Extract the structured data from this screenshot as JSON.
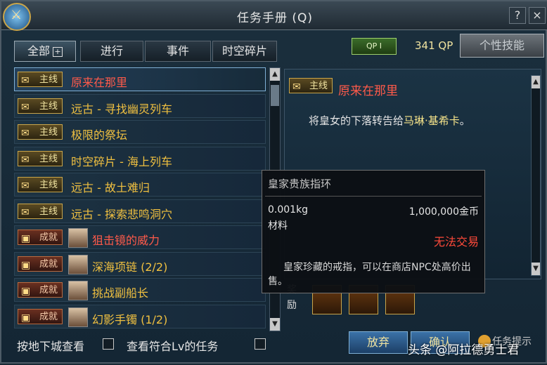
{
  "window": {
    "title": "任务手册 (Q)",
    "help": "?",
    "close": "×"
  },
  "tabs": [
    {
      "label": "全部",
      "plus": "+"
    },
    {
      "label": "进行"
    },
    {
      "label": "事件"
    },
    {
      "label": "时空碎片"
    }
  ],
  "qp": {
    "badge": "QP I",
    "value": "341 QP"
  },
  "skill_button": "个性技能",
  "quests": [
    {
      "tag": "主线",
      "type": "main",
      "title": "原来在那里",
      "color": "#ff5a4a"
    },
    {
      "tag": "主线",
      "type": "main",
      "title": "远古 - 寻找幽灵列车",
      "color": "#f0c040"
    },
    {
      "tag": "主线",
      "type": "main",
      "title": "极限的祭坛",
      "color": "#f0c040"
    },
    {
      "tag": "主线",
      "type": "main",
      "title": "时空碎片 - 海上列车",
      "color": "#f0c040"
    },
    {
      "tag": "主线",
      "type": "main",
      "title": "远古 - 故土难归",
      "color": "#f0c040"
    },
    {
      "tag": "主线",
      "type": "main",
      "title": "远古 - 探索悲鸣洞穴",
      "color": "#f0c040"
    },
    {
      "tag": "成就",
      "type": "achievement",
      "title": "狙击镜的威力",
      "color": "#ff5a4a"
    },
    {
      "tag": "成就",
      "type": "achievement",
      "title": "深海项链 (2/2)",
      "color": "#f0c040"
    },
    {
      "tag": "成就",
      "type": "achievement",
      "title": "挑战副船长",
      "color": "#f0c040"
    },
    {
      "tag": "成就",
      "type": "achievement",
      "title": "幻影手镯 (1/2)",
      "color": "#f0c040"
    }
  ],
  "detail": {
    "tag": "主线",
    "title": "原来在那里",
    "desc_pre": "将皇女的下落转告给",
    "desc_hl": "马琳·基希卡",
    "desc_post": "。"
  },
  "reward_label": "奖励",
  "tooltip": {
    "name": "皇家贵族指环",
    "weight": "0.001kg",
    "price": "1,000,000金币",
    "type": "材料",
    "trade": "无法交易",
    "desc": "皇家珍藏的戒指，可以在商店NPC处高价出售。"
  },
  "footer": {
    "check_dungeon": "按地下城查看",
    "check_lv": "查看符合Lv的任务",
    "abandon": "放弃",
    "confirm": "确认",
    "hint": "任务提示"
  },
  "watermark": "头条 @阿拉德勇士君"
}
